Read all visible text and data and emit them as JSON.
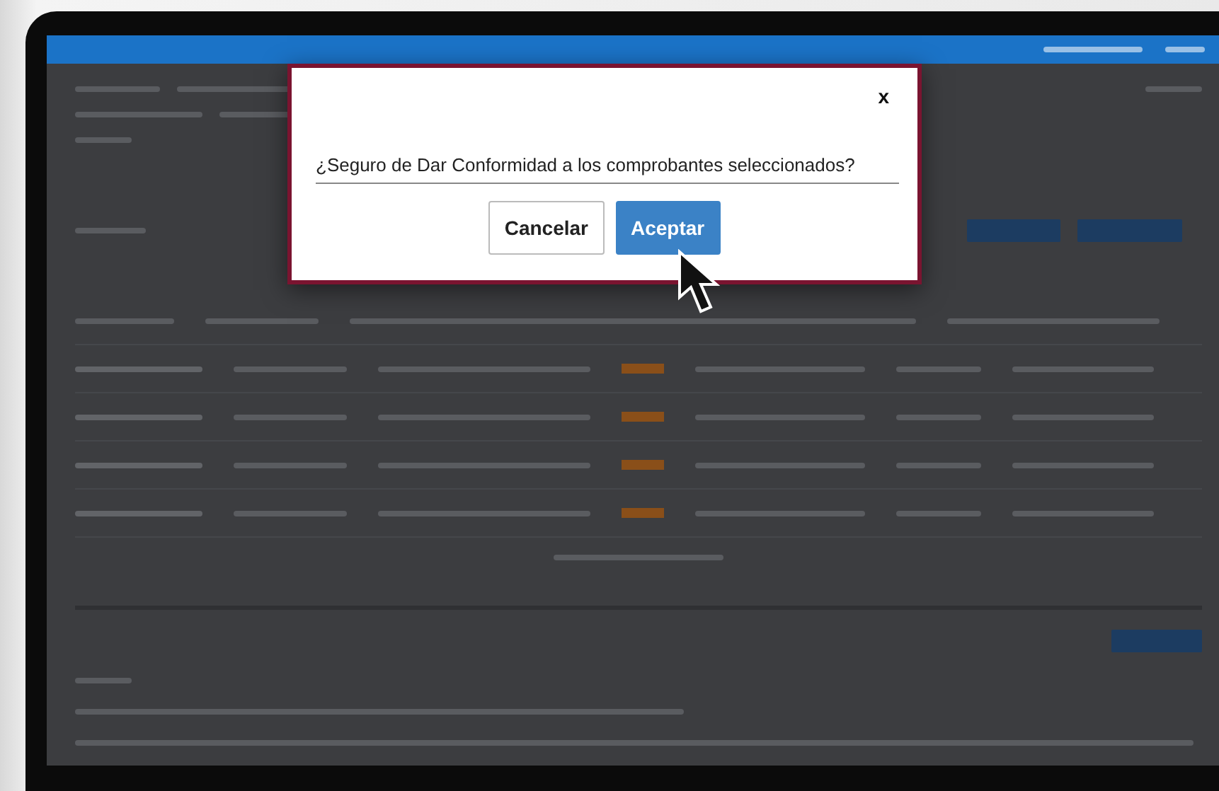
{
  "dialog": {
    "close": "x",
    "message": "¿Seguro de Dar Conformidad a los comprobantes seleccionados?",
    "buttons": [
      {
        "label": "Cancelar",
        "kind": "secondary"
      },
      {
        "label": "Aceptar",
        "kind": "primary"
      }
    ]
  }
}
